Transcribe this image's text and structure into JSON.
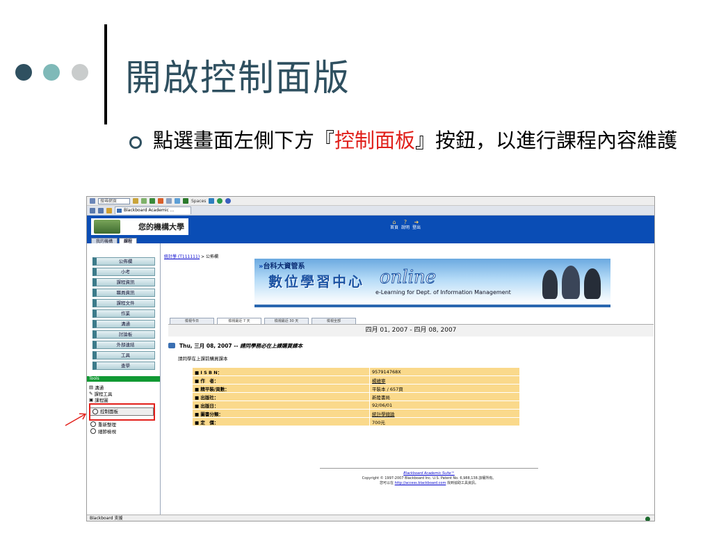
{
  "slide": {
    "title": "開啟控制面版",
    "bullet_before": "點選畫面左側下方『",
    "bullet_highlight": "控制面板",
    "bullet_after": "』按鈕，以進行課程內容維護"
  },
  "colors": {
    "title": "#2f5060",
    "highlight": "#e0201b",
    "bb_blue": "#0a4db5",
    "table_cell": "#fad98b"
  },
  "browser": {
    "search_placeholder": "搜尋網頁",
    "toolbar_spaces": "Spaces",
    "tab_label": "Blackboard Academic ...",
    "status_text": "Blackboard 支援"
  },
  "bb": {
    "institution": "您的機構大學",
    "top_links": [
      {
        "icon": "home-icon",
        "label": "首頁"
      },
      {
        "icon": "help-icon",
        "label": "說明"
      },
      {
        "icon": "logout-icon",
        "label": "登出"
      }
    ],
    "nav_tabs": [
      "我的機構",
      "課程"
    ],
    "course_menu": [
      "公佈欄",
      "小考",
      "課程資訊",
      "職員資訊",
      "課程文件",
      "作業",
      "溝通",
      "討論板",
      "外部連結",
      "工具",
      "查學"
    ],
    "tools_heading": "Tools",
    "tools": [
      "溝通",
      "課程工具",
      "課程圖"
    ],
    "control_panel": "控制面板",
    "tools_extra": [
      "重新整理",
      "細節檢視"
    ]
  },
  "content": {
    "breadcrumb_link": "統計學 (T111111)",
    "breadcrumb_rest": " > 公佈欄",
    "banner_dept": "台科大資管系",
    "banner_big": "數位學習中心",
    "banner_online": "online",
    "banner_sub": "e-Learning for Dept. of Information Management",
    "week_tabs": [
      "檢視今日",
      "檢視最近 7 天",
      "檢視最近 30 天",
      "檢視全部"
    ],
    "date_range": "四月 01, 2007 - 四月 08, 2007",
    "post_date": "Thu, 三月 08, 2007 -- ",
    "post_title": "請同學務必在上課購買課本",
    "post_body": "請同學在上課前購買課本",
    "book_rows": [
      {
        "key": "I S B N：",
        "value": "957914768X",
        "link": false
      },
      {
        "key": "作　者：",
        "value": "楊維寧",
        "link": true
      },
      {
        "key": "精平裝/頁數：",
        "value": "平裝本 / 657頁",
        "link": false
      },
      {
        "key": "出版社：",
        "value": "新陸書局",
        "link": false
      },
      {
        "key": "出版日：",
        "value": "92/06/01",
        "link": false
      },
      {
        "key": "圖書分類：",
        "value": "統計學總論",
        "link": true
      },
      {
        "key": "定　價：",
        "value": "700元",
        "link": false
      }
    ],
    "footer_suite": "Blackboard Academic Suite™",
    "footer_copyright": "Copyright © 1997-2007 Blackboard Inc. U.S. Patent No. 6,988,138.該權所有。",
    "footer_pre": "您可以在 ",
    "footer_link": "http://access.blackboard.com",
    "footer_post": " 找到協助工具資訊。"
  }
}
